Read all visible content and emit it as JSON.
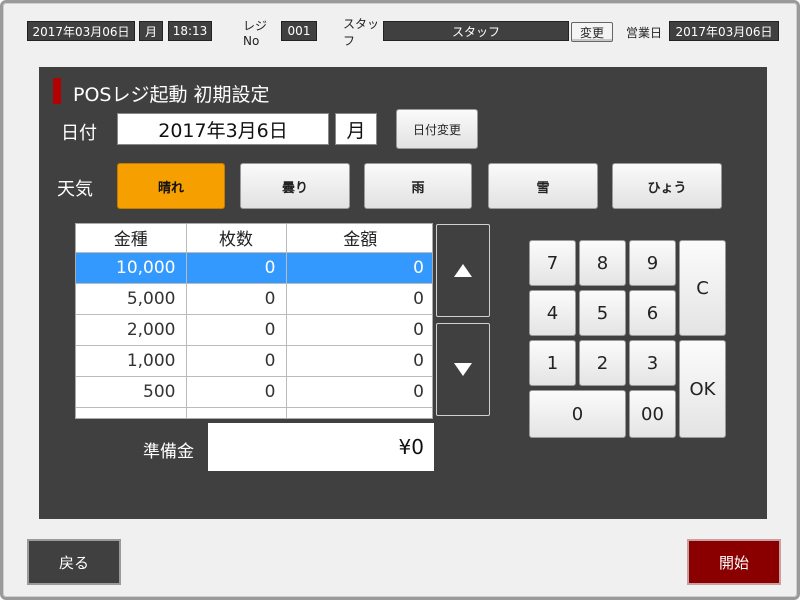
{
  "header": {
    "date": "2017年03月06日",
    "weekday": "月",
    "time": "18:13",
    "register_label": "レジNo",
    "register_no": "001",
    "staff_label": "スタッフ",
    "staff_value": "スタッフ",
    "change_button": "変更",
    "business_day_label": "営業日",
    "business_day": "2017年03月06日"
  },
  "main": {
    "title": "POSレジ起動 初期設定",
    "date_label": "日付",
    "date_value": "2017年3月6日",
    "weekday_value": "月",
    "date_change_button": "日付変更",
    "weather_label": "天気",
    "weather_options": [
      {
        "label": "晴れ",
        "selected": true
      },
      {
        "label": "曇り",
        "selected": false
      },
      {
        "label": "雨",
        "selected": false
      },
      {
        "label": "雪",
        "selected": false
      },
      {
        "label": "ひょう",
        "selected": false
      }
    ],
    "table": {
      "headers": [
        "金種",
        "枚数",
        "金額"
      ],
      "rows": [
        {
          "denomination": "10,000",
          "count": "0",
          "amount": "0",
          "selected": true
        },
        {
          "denomination": "5,000",
          "count": "0",
          "amount": "0",
          "selected": false
        },
        {
          "denomination": "2,000",
          "count": "0",
          "amount": "0",
          "selected": false
        },
        {
          "denomination": "1,000",
          "count": "0",
          "amount": "0",
          "selected": false
        },
        {
          "denomination": "500",
          "count": "0",
          "amount": "0",
          "selected": false
        },
        {
          "denomination": "",
          "count": "",
          "amount": "",
          "selected": false
        }
      ]
    },
    "reserve_label": "準備金",
    "reserve_value": "¥0",
    "keypad": {
      "k7": "7",
      "k8": "8",
      "k9": "9",
      "k4": "4",
      "k5": "5",
      "k6": "6",
      "k1": "1",
      "k2": "2",
      "k3": "3",
      "k0": "0",
      "k00": "00",
      "clear": "C",
      "ok": "OK"
    }
  },
  "footer": {
    "back_button": "戻る",
    "start_button": "開始"
  },
  "colors": {
    "panel_bg": "#404040",
    "selected_weather": "#f5a000",
    "selected_row": "#3399ff",
    "accent_red": "#8a0000"
  }
}
